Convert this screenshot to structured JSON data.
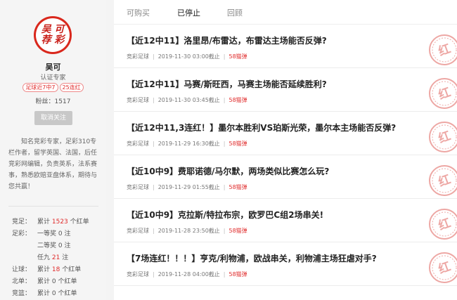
{
  "profile": {
    "avatar_text_1": "吴 可",
    "avatar_text_2": "荐 彩",
    "name": "吴可",
    "role": "认证专家",
    "tags": [
      "足球近7中7",
      "25连红"
    ],
    "fans_label": "粉丝：",
    "fans_count": "1517",
    "unfollow_label": "取消关注",
    "bio": "知名竞彩专家，足彩310专栏作者，留学英国、法国，后任竞彩网编辑，负责英系，法系赛事，熟悉欧赔亚盘体系，期待与您共赢！"
  },
  "stats": [
    {
      "category": "竞足：",
      "prefix": "累计 ",
      "value": "1523",
      "suffix": " 个红单",
      "highlight": true
    },
    {
      "category": "足彩：",
      "prefix": "一等奖 ",
      "value": "0",
      "suffix": " 注",
      "highlight": false
    },
    {
      "category": "",
      "prefix": "二等奖 ",
      "value": "0",
      "suffix": " 注",
      "highlight": false
    },
    {
      "category": "",
      "prefix": "任九 ",
      "value": "21",
      "suffix": " 注",
      "highlight": true
    },
    {
      "category": "让球：",
      "prefix": "累计 ",
      "value": "18",
      "suffix": " 个红单",
      "highlight": true
    },
    {
      "category": "北单：",
      "prefix": "累计 ",
      "value": "0",
      "suffix": " 个红单",
      "highlight": false
    },
    {
      "category": "竞篮：",
      "prefix": "累计 ",
      "value": "0",
      "suffix": " 个红单",
      "highlight": false
    }
  ],
  "tabs": [
    {
      "label": "可购买",
      "active": false
    },
    {
      "label": "已停止",
      "active": true
    },
    {
      "label": "回顾",
      "active": false
    }
  ],
  "articles": [
    {
      "title": "【近12中11】洛里昂/布雷达，布雷达主场能否反弹?",
      "category": "竞彩足球",
      "time": "2019-11-30 03:00截止",
      "price": "58猫弹"
    },
    {
      "title": "【近12中11】马赛/斯旺西，马赛主场能否延续胜利?",
      "category": "竞彩足球",
      "time": "2019-11-30 03:45截止",
      "price": "58猫弹"
    },
    {
      "title": "【近12中11,3连红！】墨尔本胜利VS珀斯光荣，墨尔本主场能否反弹?",
      "category": "竞彩足球",
      "time": "2019-11-29 16:30截止",
      "price": "58猫弹"
    },
    {
      "title": "【近10中9】费耶诺德/马尔默，两场类似比赛怎么玩?",
      "category": "竞彩足球",
      "time": "2019-11-29 01:55截止",
      "price": "58猫弹"
    },
    {
      "title": "【近10中9】克拉斯/特拉布宗，欧罗巴C组2场串关!",
      "category": "竞彩足球",
      "time": "2019-11-28 23:50截止",
      "price": "58猫弹"
    },
    {
      "title": "【7场连红！！！】亨克/利物浦，欧战串关，利物浦主场狂虐对手?",
      "category": "竞彩足球",
      "time": "2019-11-28 04:00截止",
      "price": "58猫弹"
    }
  ],
  "stamp_text": "红",
  "colors": {
    "accent": "#e02b2b",
    "stamp": "#e0605a"
  }
}
